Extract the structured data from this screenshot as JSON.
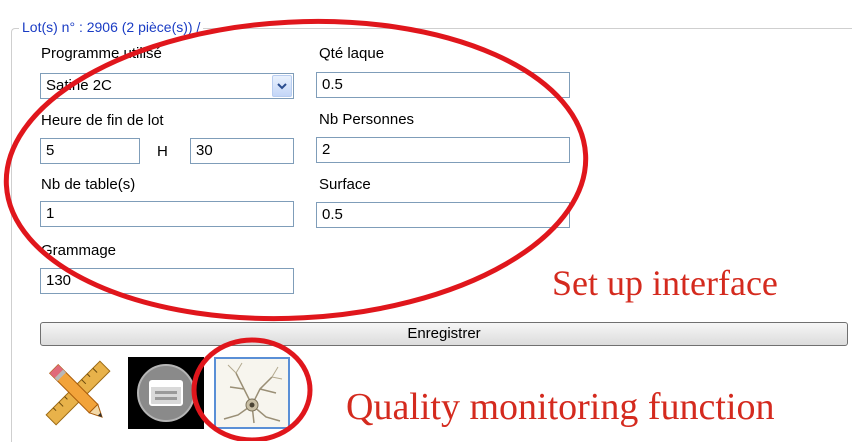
{
  "group": {
    "legend": "Lot(s) n° : 2906 (2 pièce(s)) /"
  },
  "form": {
    "programme_label": "Programme utilisé",
    "programme_value": "Satine 2C",
    "qte_laque_label": "Qté laque",
    "qte_laque_value": "0.5",
    "heure_label": "Heure de fin de lot",
    "heure_value": "5",
    "h_separator": "H",
    "minute_value": "30",
    "nb_personnes_label": "Nb Personnes",
    "nb_personnes_value": "2",
    "nb_tables_label": "Nb de table(s)",
    "nb_tables_value": "1",
    "surface_label": "Surface",
    "surface_value": "0.5",
    "grammage_label": "Grammage",
    "grammage_value": "130"
  },
  "actions": {
    "save_label": "Enregistrer"
  },
  "toolbar": {
    "icons": [
      "ruler-pencil-icon",
      "window-icon",
      "neuron-icon"
    ]
  },
  "annotations": {
    "setup_text": "Set up interface",
    "quality_text": "Quality monitoring function",
    "color": "#d42a1e"
  },
  "colors": {
    "legend": "#1a3cc4",
    "field_border": "#7f9db9",
    "annotation_red": "#e0161c"
  }
}
